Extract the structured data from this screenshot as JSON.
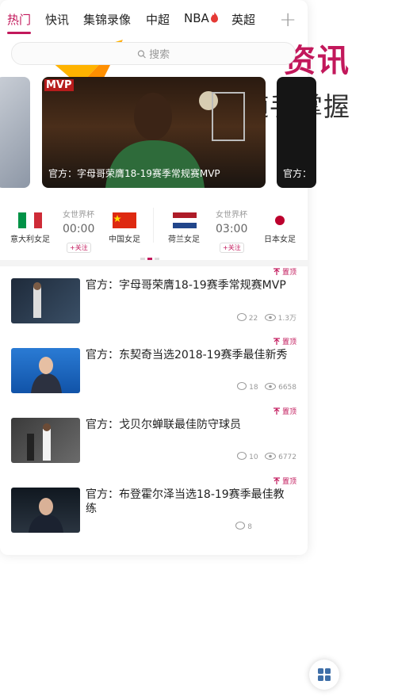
{
  "hero": {
    "title": "资讯",
    "subtitle": "热点随手掌握"
  },
  "tabs": [
    {
      "label": "热门"
    },
    {
      "label": "快讯"
    },
    {
      "label": "集锦录像"
    },
    {
      "label": "中超"
    },
    {
      "label": "NBA"
    },
    {
      "label": "英超"
    }
  ],
  "search": {
    "placeholder": "搜索"
  },
  "carousel": {
    "badge": "MVP",
    "caption": "官方：字母哥荣膺18-19赛季常规赛MVP",
    "peek_caption": "官方："
  },
  "matches": [
    {
      "home": "意大利女足",
      "away": "中国女足",
      "league": "女世界杯",
      "time": "00:00",
      "follow": "+关注"
    },
    {
      "home": "荷兰女足",
      "away": "日本女足",
      "league": "女世界杯",
      "time": "03:00",
      "follow": "+关注"
    }
  ],
  "news": [
    {
      "title": "官方：字母哥荣膺18-19赛季常规赛MVP",
      "pin": "置顶",
      "comments": "22",
      "views": "1.3万"
    },
    {
      "title": "官方：东契奇当选2018-19赛季最佳新秀",
      "pin": "置顶",
      "comments": "18",
      "views": "6658"
    },
    {
      "title": "官方：戈贝尔蝉联最佳防守球员",
      "pin": "置顶",
      "comments": "10",
      "views": "6772"
    },
    {
      "title": "官方：布登霍尔泽当选18-19赛季最佳教练",
      "pin": "置顶",
      "comments": "8",
      "views": ""
    }
  ],
  "colors": {
    "accent": "#c2185b"
  },
  "icons": {
    "add": "plus-icon",
    "search": "search-icon",
    "fire": "fire-icon",
    "pin": "pin-icon",
    "comment": "comment-icon",
    "view": "eye-icon",
    "grid": "grid-icon"
  }
}
